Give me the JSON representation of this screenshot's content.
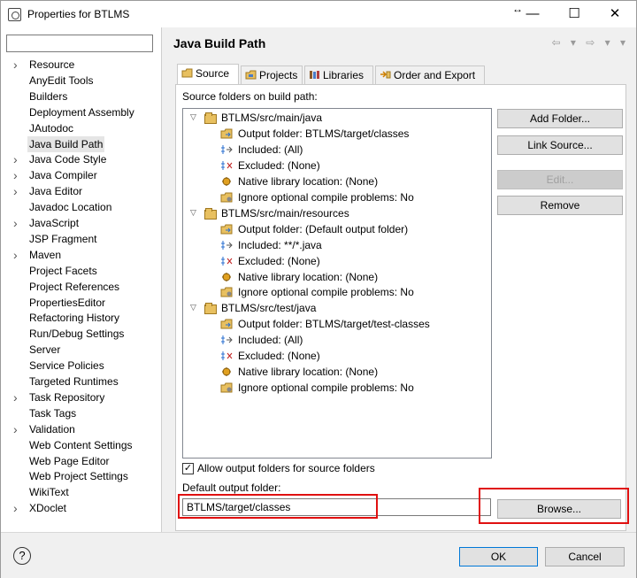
{
  "window": {
    "title": "Properties for BTLMS",
    "resize_glyph": "↔",
    "minimize": "—",
    "maximize": "☐",
    "close": "✕"
  },
  "sidebar": {
    "filter_placeholder": "",
    "items": [
      {
        "label": "Resource",
        "expandable": true
      },
      {
        "label": "AnyEdit Tools",
        "expandable": false
      },
      {
        "label": "Builders",
        "expandable": false
      },
      {
        "label": "Deployment Assembly",
        "expandable": false
      },
      {
        "label": "JAutodoc",
        "expandable": false
      },
      {
        "label": "Java Build Path",
        "expandable": false,
        "selected": true
      },
      {
        "label": "Java Code Style",
        "expandable": true
      },
      {
        "label": "Java Compiler",
        "expandable": true
      },
      {
        "label": "Java Editor",
        "expandable": true
      },
      {
        "label": "Javadoc Location",
        "expandable": false
      },
      {
        "label": "JavaScript",
        "expandable": true
      },
      {
        "label": "JSP Fragment",
        "expandable": false
      },
      {
        "label": "Maven",
        "expandable": true
      },
      {
        "label": "Project Facets",
        "expandable": false
      },
      {
        "label": "Project References",
        "expandable": false
      },
      {
        "label": "PropertiesEditor",
        "expandable": false
      },
      {
        "label": "Refactoring History",
        "expandable": false
      },
      {
        "label": "Run/Debug Settings",
        "expandable": false
      },
      {
        "label": "Server",
        "expandable": false
      },
      {
        "label": "Service Policies",
        "expandable": false
      },
      {
        "label": "Targeted Runtimes",
        "expandable": false
      },
      {
        "label": "Task Repository",
        "expandable": true
      },
      {
        "label": "Task Tags",
        "expandable": false
      },
      {
        "label": "Validation",
        "expandable": true
      },
      {
        "label": "Web Content Settings",
        "expandable": false
      },
      {
        "label": "Web Page Editor",
        "expandable": false
      },
      {
        "label": "Web Project Settings",
        "expandable": false
      },
      {
        "label": "WikiText",
        "expandable": false
      },
      {
        "label": "XDoclet",
        "expandable": true
      }
    ]
  },
  "main": {
    "title": "Java Build Path",
    "nav": "⇦ ▾ ⇨ ▾ ▾",
    "tabs": [
      {
        "label": "Source",
        "active": true
      },
      {
        "label": "Projects",
        "active": false
      },
      {
        "label": "Libraries",
        "active": false
      },
      {
        "label": "Order and Export",
        "active": false
      }
    ],
    "source_label": "Source folders on build path:",
    "folders": [
      {
        "name": "BTLMS/src/main/java",
        "children": [
          {
            "icon": "output-folder-icon",
            "label": "Output folder: BTLMS/target/classes"
          },
          {
            "icon": "included-icon",
            "label": "Included: (All)"
          },
          {
            "icon": "excluded-icon",
            "label": "Excluded: (None)"
          },
          {
            "icon": "native-library-icon",
            "label": "Native library location: (None)"
          },
          {
            "icon": "ignore-problems-icon",
            "label": "Ignore optional compile problems: No"
          }
        ]
      },
      {
        "name": "BTLMS/src/main/resources",
        "children": [
          {
            "icon": "output-folder-icon",
            "label": "Output folder: (Default output folder)"
          },
          {
            "icon": "included-icon",
            "label": "Included: **/*.java"
          },
          {
            "icon": "excluded-icon",
            "label": "Excluded: (None)"
          },
          {
            "icon": "native-library-icon",
            "label": "Native library location: (None)"
          },
          {
            "icon": "ignore-problems-icon",
            "label": "Ignore optional compile problems: No"
          }
        ]
      },
      {
        "name": "BTLMS/src/test/java",
        "children": [
          {
            "icon": "output-folder-icon",
            "label": "Output folder: BTLMS/target/test-classes"
          },
          {
            "icon": "included-icon",
            "label": "Included: (All)"
          },
          {
            "icon": "excluded-icon",
            "label": "Excluded: (None)"
          },
          {
            "icon": "native-library-icon",
            "label": "Native library location: (None)"
          },
          {
            "icon": "ignore-problems-icon",
            "label": "Ignore optional compile problems: No"
          }
        ]
      }
    ],
    "buttons": {
      "add_folder": "Add Folder...",
      "link_source": "Link Source...",
      "edit": "Edit...",
      "remove": "Remove",
      "browse": "Browse..."
    },
    "allow_output_label": "Allow output folders for source folders",
    "allow_output_checked": true,
    "allow_output_check": "✓",
    "default_output_label": "Default output folder:",
    "default_output_value": "BTLMS/target/classes"
  },
  "footer": {
    "help_glyph": "?",
    "ok": "OK",
    "cancel": "Cancel"
  },
  "colors": {
    "highlight": "#e01010",
    "ok_border": "#0078d7"
  }
}
